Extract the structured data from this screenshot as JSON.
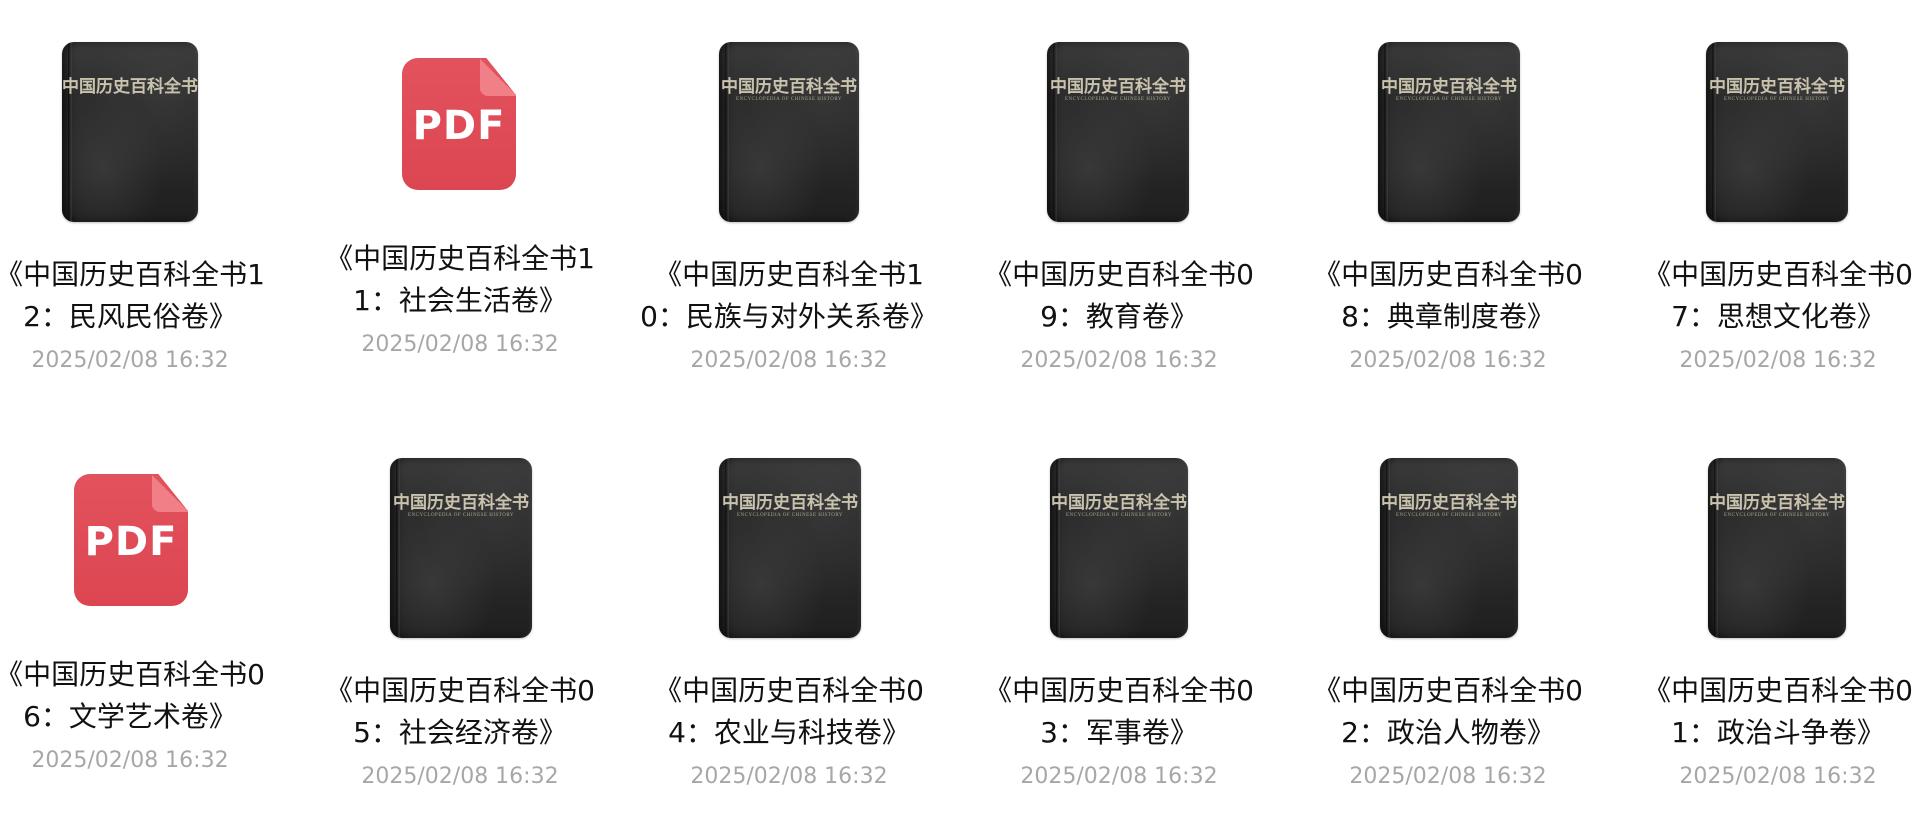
{
  "files": [
    {
      "name": "《中国历史百科全书12：民风民俗卷》",
      "date": "2025/02/08 16:32",
      "kind": "book",
      "icon": "book-cover-icon",
      "cover_title": "中国历史百科全书",
      "cover_en": "",
      "cover_vol": ""
    },
    {
      "name": "《中国历史百科全书11：社会生活卷》",
      "date": "2025/02/08 16:32",
      "kind": "pdf",
      "icon": "pdf-icon",
      "icon_label": "PDF"
    },
    {
      "name": "《中国历史百科全书10：民族与对外关系卷》",
      "date": "2025/02/08 16:32",
      "kind": "book",
      "icon": "book-cover-icon",
      "cover_title": "中国历史百科全书",
      "cover_en": "ENCYCLOPEDIA OF CHINESE HISTORY",
      "cover_vol": ""
    },
    {
      "name": "《中国历史百科全书09：教育卷》",
      "date": "2025/02/08 16:32",
      "kind": "book",
      "icon": "book-cover-icon",
      "cover_title": "中国历史百科全书",
      "cover_en": "ENCYCLOPEDIA OF CHINESE HISTORY",
      "cover_vol": ""
    },
    {
      "name": "《中国历史百科全书08：典章制度卷》",
      "date": "2025/02/08 16:32",
      "kind": "book",
      "icon": "book-cover-icon",
      "cover_title": "中国历史百科全书",
      "cover_en": "ENCYCLOPEDIA OF CHINESE HISTORY",
      "cover_vol": ""
    },
    {
      "name": "《中国历史百科全书07：思想文化卷》",
      "date": "2025/02/08 16:32",
      "kind": "book",
      "icon": "book-cover-icon",
      "cover_title": "中国历史百科全书",
      "cover_en": "ENCYCLOPEDIA OF CHINESE HISTORY",
      "cover_vol": ""
    },
    {
      "name": "《中国历史百科全书06：文学艺术卷》",
      "date": "2025/02/08 16:32",
      "kind": "pdf",
      "icon": "pdf-icon",
      "icon_label": "PDF"
    },
    {
      "name": "《中国历史百科全书05：社会经济卷》",
      "date": "2025/02/08 16:32",
      "kind": "book",
      "icon": "book-cover-icon",
      "cover_title": "中国历史百科全书",
      "cover_en": "ENCYCLOPEDIA OF CHINESE HISTORY",
      "cover_vol": ""
    },
    {
      "name": "《中国历史百科全书04：农业与科技卷》",
      "date": "2025/02/08 16:32",
      "kind": "book",
      "icon": "book-cover-icon",
      "cover_title": "中国历史百科全书",
      "cover_en": "ENCYCLOPEDIA OF CHINESE HISTORY",
      "cover_vol": ""
    },
    {
      "name": "《中国历史百科全书03：军事卷》",
      "date": "2025/02/08 16:32",
      "kind": "book",
      "icon": "book-cover-icon",
      "cover_title": "中国历史百科全书",
      "cover_en": "ENCYCLOPEDIA OF CHINESE HISTORY",
      "cover_vol": ""
    },
    {
      "name": "《中国历史百科全书02：政治人物卷》",
      "date": "2025/02/08 16:32",
      "kind": "book",
      "icon": "book-cover-icon",
      "cover_title": "中国历史百科全书",
      "cover_en": "ENCYCLOPEDIA OF CHINESE HISTORY",
      "cover_vol": ""
    },
    {
      "name": "《中国历史百科全书01：政治斗争卷》",
      "date": "2025/02/08 16:32",
      "kind": "book",
      "icon": "book-cover-icon",
      "cover_title": "中国历史百科全书",
      "cover_en": "ENCYCLOPEDIA OF CHINESE HISTORY",
      "cover_vol": ""
    }
  ],
  "colors": {
    "pdf_red": "#e04b56",
    "date_gray": "#a7a7a7",
    "name_black": "#111111",
    "cover_dark": "#2b2b2b",
    "cover_gold": "#c9c3ae"
  }
}
